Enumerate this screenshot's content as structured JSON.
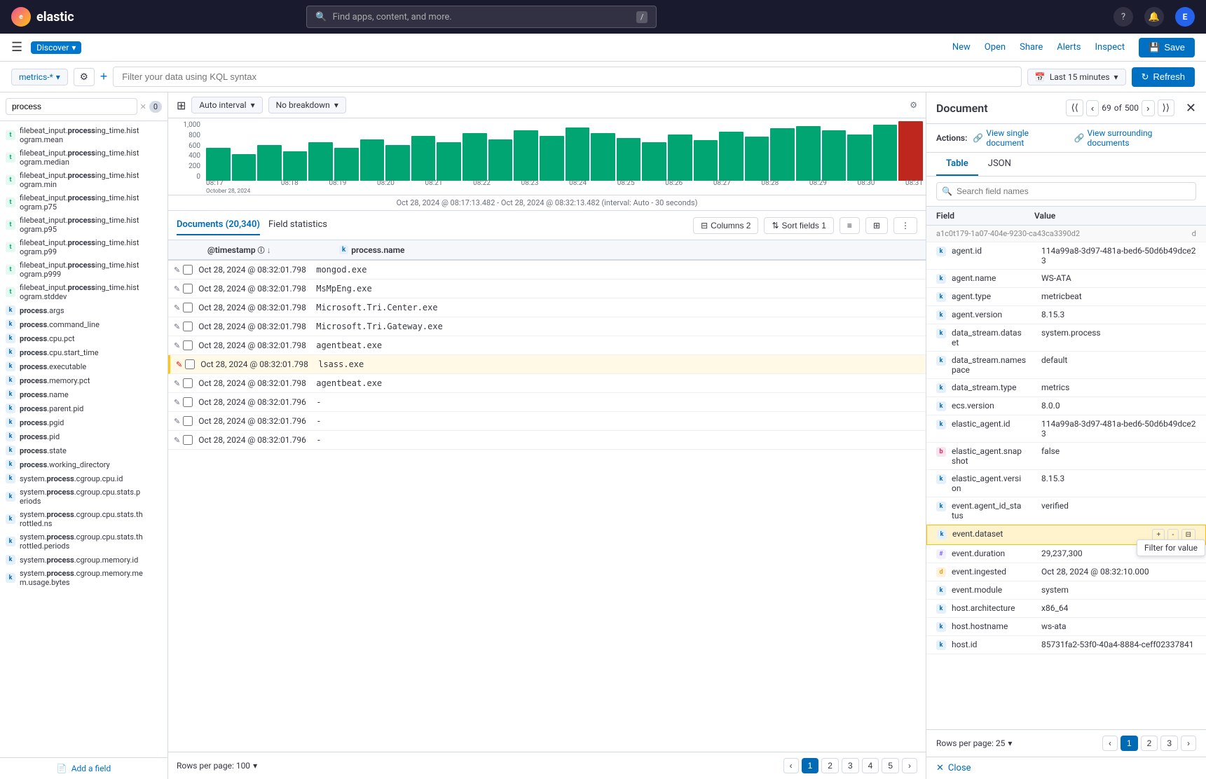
{
  "topNav": {
    "logoText": "elastic",
    "searchPlaceholder": "Find apps, content, and more.",
    "keyboardShortcut": "/",
    "navLinks": [
      "New",
      "Open",
      "Share",
      "Alerts",
      "Inspect"
    ],
    "saveLabel": "Save"
  },
  "secondNav": {
    "appName": "Discover",
    "dropdownArrow": "▾"
  },
  "filterBar": {
    "indexPattern": "metrics-*",
    "kqlPlaceholder": "Filter your data using KQL syntax",
    "timeRange": "Last 15 minutes",
    "refreshLabel": "Refresh"
  },
  "chart": {
    "autoInterval": "Auto interval",
    "noBreakdown": "No breakdown",
    "yAxisLabels": [
      "1,000",
      "800",
      "600",
      "400",
      "200",
      "0"
    ],
    "xAxisLabels": [
      "08:17",
      "08:18",
      "08:19",
      "08:20",
      "08:21",
      "08:22",
      "08:23",
      "08:24",
      "08:25",
      "08:26",
      "08:27",
      "08:28",
      "08:29",
      "08:30",
      "08:31"
    ],
    "timeLabel": "Oct 28, 2024 @ 08:17:13.482 - Oct 28, 2024 @ 08:32:13.482 (interval: Auto - 30 seconds)"
  },
  "tableHeader": {
    "documentsTab": "Documents (20,340)",
    "fieldStatsTab": "Field statistics",
    "columnsBtn": "Columns 2",
    "sortFieldsBtn": "Sort fields 1"
  },
  "tableColumns": {
    "timestamp": "@timestamp",
    "processName": "process.name"
  },
  "rows": [
    {
      "timestamp": "Oct 28, 2024 @ 08:32:01.798",
      "value": "mongod.exe",
      "highlighted": false
    },
    {
      "timestamp": "Oct 28, 2024 @ 08:32:01.798",
      "value": "MsMpEng.exe",
      "highlighted": false
    },
    {
      "timestamp": "Oct 28, 2024 @ 08:32:01.798",
      "value": "Microsoft.Tri.Center.exe",
      "highlighted": false
    },
    {
      "timestamp": "Oct 28, 2024 @ 08:32:01.798",
      "value": "Microsoft.Tri.Gateway.exe",
      "highlighted": false
    },
    {
      "timestamp": "Oct 28, 2024 @ 08:32:01.798",
      "value": "agentbeat.exe",
      "highlighted": false
    },
    {
      "timestamp": "Oct 28, 2024 @ 08:32:01.798",
      "value": "lsass.exe",
      "highlighted": true
    },
    {
      "timestamp": "Oct 28, 2024 @ 08:32:01.798",
      "value": "agentbeat.exe",
      "highlighted": false
    },
    {
      "timestamp": "Oct 28, 2024 @ 08:32:01.796",
      "value": "-",
      "highlighted": false
    },
    {
      "timestamp": "Oct 28, 2024 @ 08:32:01.796",
      "value": "-",
      "highlighted": false
    },
    {
      "timestamp": "Oct 28, 2024 @ 08:32:01.796",
      "value": "-",
      "highlighted": false
    }
  ],
  "pagination": {
    "rowsPerPage": "Rows per page: 100",
    "pages": [
      "1",
      "2",
      "3",
      "4",
      "5"
    ],
    "nextLabel": "›"
  },
  "sidebar": {
    "searchPlaceholder": "process",
    "filterCount": "0",
    "fields": [
      {
        "type": "t",
        "name": "filebeat_input.processing_time.histogram.mean"
      },
      {
        "type": "t",
        "name": "filebeat_input.processing_time.histogram.median"
      },
      {
        "type": "t",
        "name": "filebeat_input.processing_time.histogram.min"
      },
      {
        "type": "t",
        "name": "filebeat_input.processing_time.histogram.p75"
      },
      {
        "type": "t",
        "name": "filebeat_input.processing_time.histogram.p95"
      },
      {
        "type": "t",
        "name": "filebeat_input.processing_time.histogram.p99"
      },
      {
        "type": "t",
        "name": "filebeat_input.processing_time.histogram.p999"
      },
      {
        "type": "t",
        "name": "filebeat_input.processing_time.histogram.stddev"
      },
      {
        "type": "k",
        "name": "process.args"
      },
      {
        "type": "k",
        "name": "process.command_line"
      },
      {
        "type": "k",
        "name": "process.cpu.pct"
      },
      {
        "type": "k",
        "name": "process.cpu.start_time"
      },
      {
        "type": "k",
        "name": "process.executable"
      },
      {
        "type": "k",
        "name": "process.memory.pct"
      },
      {
        "type": "k",
        "name": "process.name"
      },
      {
        "type": "k",
        "name": "process.parent.pid"
      },
      {
        "type": "k",
        "name": "process.pgid"
      },
      {
        "type": "k",
        "name": "process.pid"
      },
      {
        "type": "k",
        "name": "process.state"
      },
      {
        "type": "k",
        "name": "process.working_directory"
      },
      {
        "type": "k",
        "name": "system.process.cgroup.cpu.id"
      },
      {
        "type": "k",
        "name": "system.process.cgroup.cpu.stats.periods"
      },
      {
        "type": "k",
        "name": "system.process.cgroup.cpu.stats.throttled.ns"
      },
      {
        "type": "k",
        "name": "system.process.cgroup.cpu.stats.throttled.periods"
      },
      {
        "type": "k",
        "name": "system.process.cgroup.memory.id"
      },
      {
        "type": "k",
        "name": "system.process.cgroup.memory.mem.usage.bytes"
      }
    ],
    "addFieldLabel": "Add a field"
  },
  "docPanel": {
    "title": "Document",
    "current": "69",
    "total": "500",
    "actions": {
      "label": "Actions:",
      "viewSingle": "View single document",
      "viewSurrounding": "View surrounding documents"
    },
    "tabs": [
      "Table",
      "JSON"
    ],
    "activeTab": "Table",
    "fieldSearchPlaceholder": "Search field names",
    "fields": [
      {
        "type": "k",
        "name": "agent.id",
        "value": "114a99a8-3d97-481a-bed6-50d6b49dce23"
      },
      {
        "type": "k",
        "name": "agent.name",
        "value": "WS-ATA"
      },
      {
        "type": "k",
        "name": "agent.type",
        "value": "metricbeat"
      },
      {
        "type": "k",
        "name": "agent.version",
        "value": "8.15.3"
      },
      {
        "type": "k",
        "name": "data_stream.dataset",
        "value": "system.process"
      },
      {
        "type": "k",
        "name": "data_stream.namespace",
        "value": "default"
      },
      {
        "type": "k",
        "name": "data_stream.type",
        "value": "metrics"
      },
      {
        "type": "k",
        "name": "ecs.version",
        "value": "8.0.0"
      },
      {
        "type": "k",
        "name": "elastic_agent.id",
        "value": "114a99a8-3d97-481a-bed6-50d6b49dce23"
      },
      {
        "type": "bool",
        "name": "elastic_agent.snapshot",
        "value": "false"
      },
      {
        "type": "k",
        "name": "elastic_agent.version",
        "value": "8.15.3"
      },
      {
        "type": "k",
        "name": "event.agent_id_status",
        "value": "verified"
      },
      {
        "type": "k",
        "name": "event.dataset",
        "value": "",
        "showTooltip": true
      },
      {
        "type": "hash",
        "name": "event.duration",
        "value": "29,237,300"
      },
      {
        "type": "date",
        "name": "event.ingested",
        "value": "Oct 28, 2024 @ 08:32:10.000"
      },
      {
        "type": "k",
        "name": "event.module",
        "value": "system"
      },
      {
        "type": "k",
        "name": "host.architecture",
        "value": "x86_64"
      },
      {
        "type": "k",
        "name": "host.hostname",
        "value": "ws-ata"
      },
      {
        "type": "k",
        "name": "host.id",
        "value": "85731fa2-53f0-40a4-8884-ceff02337841"
      }
    ],
    "pagination": {
      "rowsPerPage": "Rows per page: 25",
      "pages": [
        "1",
        "2",
        "3"
      ]
    }
  }
}
